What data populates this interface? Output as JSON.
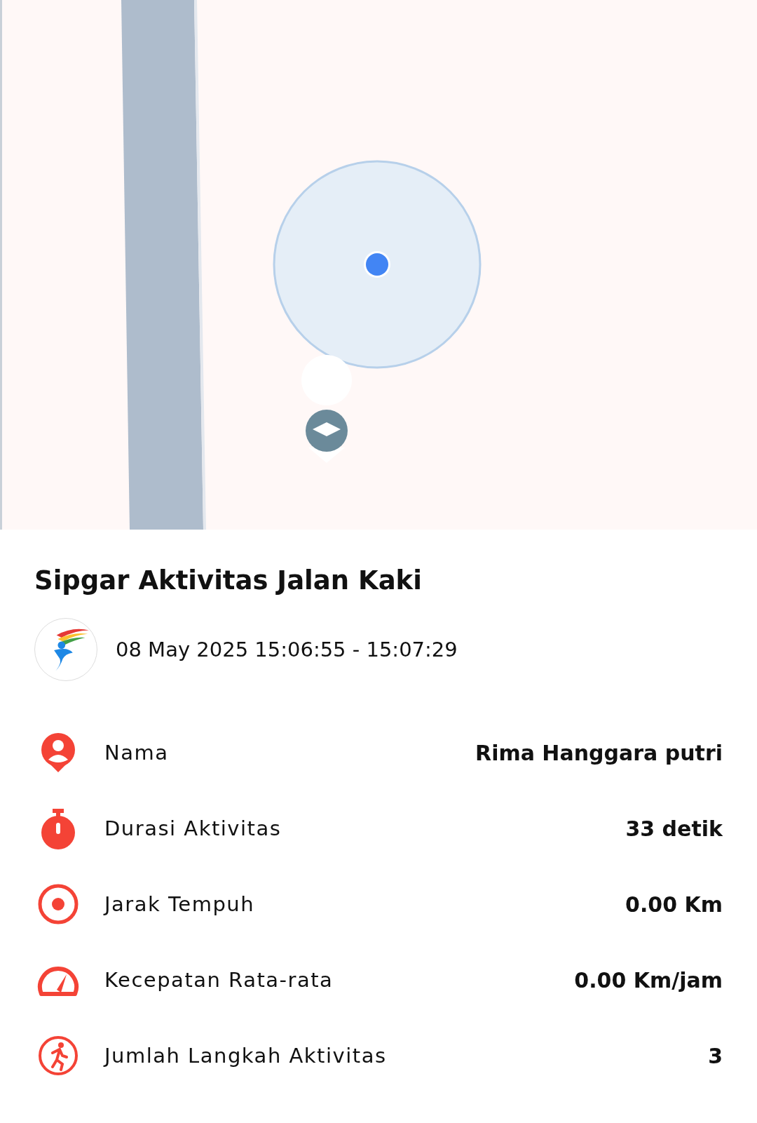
{
  "title": "Sipgar Aktivitas Jalan Kaki",
  "time_range": "08 May 2025 15:06:55 - 15:07:29",
  "stats": [
    {
      "kind": "person",
      "label": "Nama",
      "value": "Rima Hanggara putri"
    },
    {
      "kind": "timer",
      "label": "Durasi Aktivitas",
      "value": "33 detik"
    },
    {
      "kind": "target",
      "label": "Jarak Tempuh",
      "value": "0.00 Km"
    },
    {
      "kind": "speed",
      "label": "Kecepatan Rata-rata",
      "value": "0.00 Km/jam"
    },
    {
      "kind": "steps",
      "label": "Jumlah Langkah Aktivitas",
      "value": "3"
    }
  ]
}
